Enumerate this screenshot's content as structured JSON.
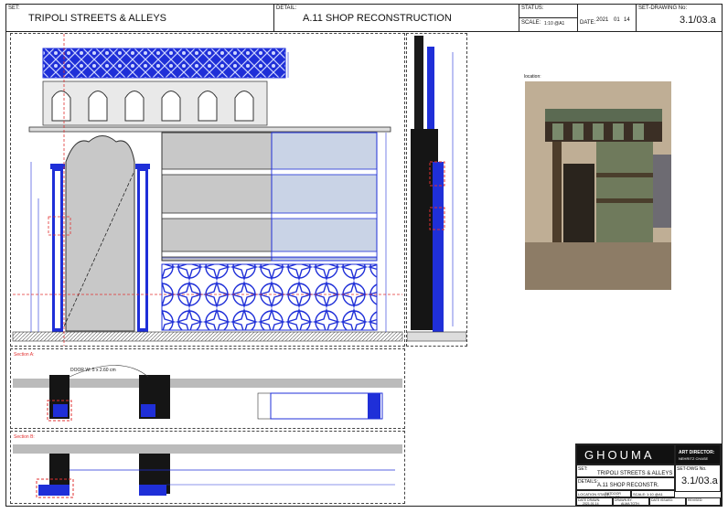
{
  "header": {
    "set_label": "SET:",
    "set_value": "TRIPOLI STREETS & ALLEYS",
    "detail_label": "DETAIL:",
    "detail_value": "A.11 SHOP RECONSTRUCTION",
    "status_label": "STATUS:",
    "scale_label": "SCALE:",
    "scale_value": "1:10 @A1",
    "date_label": "DATE:",
    "date_year": "2021",
    "date_month": "01",
    "date_day": "14",
    "drawing_no_label": "SET-DRAWING No:",
    "drawing_no_value": "3.1/03.a"
  },
  "photo": {
    "label": "location:"
  },
  "sections": {
    "section_a": "Section A:",
    "section_b": "Section B:",
    "door_note": "DOOR W: 5 x 2.60 cm"
  },
  "titleblock": {
    "logo": "GHOUMA",
    "art_director_label": "ART DIRECTOR:",
    "art_director_value": "NEHRITZ CHASE",
    "set_label": "SET:",
    "set_value": "TRIPOLI STREETS & ALLEYS",
    "drawing_no_label": "SET-DWG No.",
    "drawing_no_value": "3.1/03.a",
    "details_label": "DETAILS:",
    "details_value": "A.11 SHOP RECONSTR.",
    "location_stage_label": "LOCATION STAGE:",
    "location_stage_value": "OUTDOOR BACKLOT",
    "scale_label": "SCALE:",
    "scale_value": "1:10 @A1",
    "date_drawn_label": "DATE DRAWN:",
    "date_drawn_value": "2021.01.14",
    "drawn_by_label": "DRAWN BY:",
    "drawn_by_value": "ALMA TOTH",
    "date_issued_label": "DATE ISSUED:",
    "revised_label": "REVISED:"
  }
}
